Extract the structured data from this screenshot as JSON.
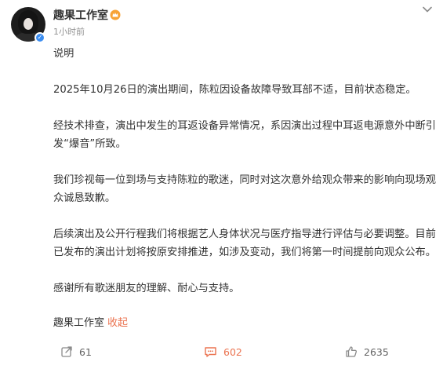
{
  "post": {
    "author": "趣果工作室",
    "time": "1小时前",
    "paragraphs": [
      "说明",
      "2025年10月26日的演出期间，陈粒因设备故障导致耳部不适，目前状态稳定。",
      "经技术排查，演出中发生的耳返设备异常情况，系因演出过程中耳返电源意外中断引发“爆音”所致。",
      "我们珍视每一位到场与支持陈粒的歌迷，同时对这次意外给观众带来的影响向现场观众诚恳致歉。",
      "后续演出及公开行程我们将根据艺人身体状况与医疗指导进行评估与必要调整。目前已发布的演出计划将按原安排推进，如涉及变动，我们将第一时间提前向观众公布。",
      "感谢所有歌迷朋友的理解、耐心与支持。"
    ],
    "signature": "趣果工作室",
    "collapse_label": "收起"
  },
  "actions": {
    "repost_count": "61",
    "comment_count": "602",
    "like_count": "2635"
  },
  "colors": {
    "accent": "#eb7350",
    "verified": "#3b8df0",
    "meta": "#939393"
  },
  "icons": [
    "crown-badge-icon",
    "chevron-down-icon",
    "verified-icon",
    "repost-icon",
    "comment-icon",
    "like-icon"
  ]
}
